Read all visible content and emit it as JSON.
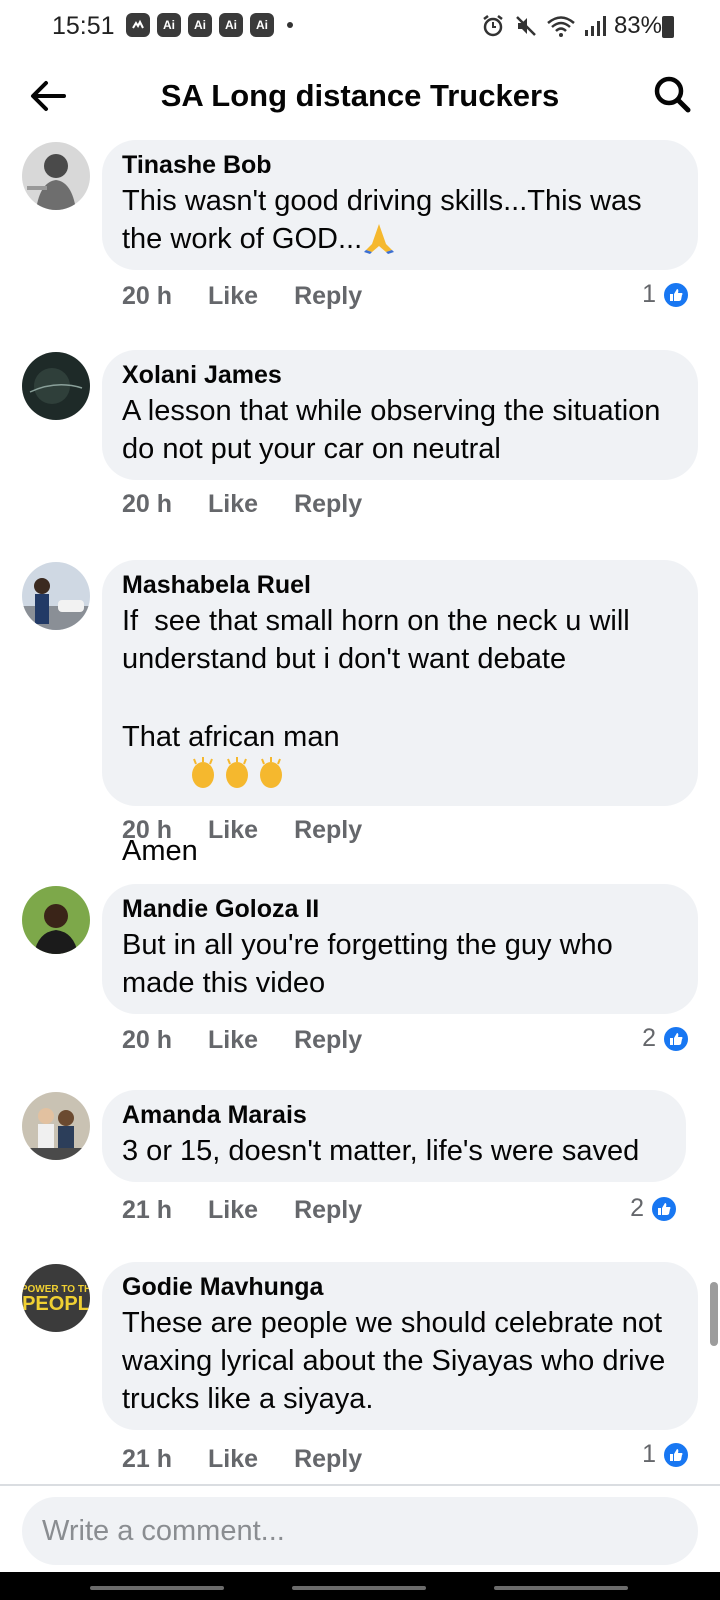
{
  "status_bar": {
    "time": "15:51",
    "notif_badges": [
      "Ai",
      "Ai",
      "Ai",
      "Ai"
    ],
    "battery": "83%"
  },
  "header": {
    "title": "SA Long distance Truckers"
  },
  "comments": [
    {
      "author": "Tinashe Bob",
      "text": "This wasn't good driving skills...This was the work of GOD...",
      "emoji": "folded-hands",
      "time": "20 h",
      "like": "Like",
      "reply": "Reply",
      "reactions": "1"
    },
    {
      "author": "Xolani James",
      "text": "A lesson that while observing the situation   do not put your car on neutral",
      "time": "20 h",
      "like": "Like",
      "reply": "Reply",
      "reactions": ""
    },
    {
      "author": "Mashabela Ruel",
      "text": "If  see that small horn on the neck u will understand but i don't want debate",
      "text2": "That african man",
      "text3": "Amen",
      "emoji": "clapping-hands",
      "time": "20 h",
      "like": "Like",
      "reply": "Reply",
      "reactions": ""
    },
    {
      "author": "Mandie Goloza II",
      "text": "But in all you're forgetting the guy who made this video",
      "time": "20 h",
      "like": "Like",
      "reply": "Reply",
      "reactions": "2"
    },
    {
      "author": "Amanda Marais",
      "text": "3 or 15, doesn't matter, life's were saved",
      "time": "21 h",
      "like": "Like",
      "reply": "Reply",
      "reactions": "2"
    },
    {
      "author": "Godie Mavhunga",
      "avatar_text": "POWER TO THE PEOPLE",
      "text": "These are people we should celebrate not waxing lyrical about the Siyayas who drive trucks like a siyaya.",
      "time": "21 h",
      "like": "Like",
      "reply": "Reply",
      "reactions": "1"
    }
  ],
  "composer": {
    "placeholder": "Write a comment..."
  },
  "colors": {
    "accent": "#1877f2",
    "bubble": "#f0f2f5",
    "meta_text": "#65676b"
  }
}
